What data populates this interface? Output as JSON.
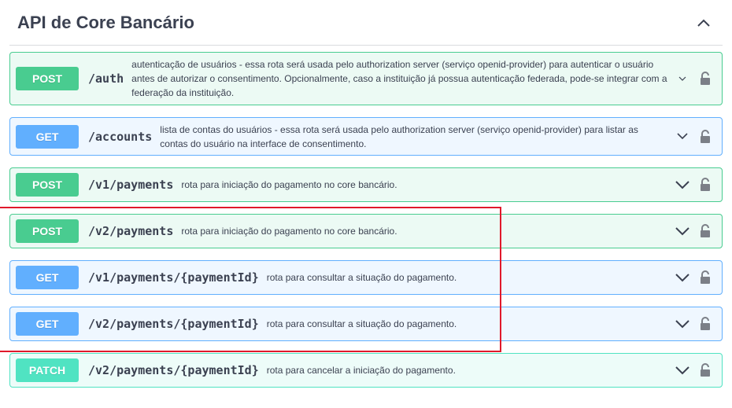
{
  "section": {
    "title": "API de Core Bancário"
  },
  "operations": [
    {
      "method": "POST",
      "path": "/auth",
      "summary": "autenticação de usuários - essa rota será usada pelo authorization server (serviço openid-provider) para autenticar o usuário antes de autorizar o consentimento. Opcionalmente, caso a instituição já possua autenticação federada, pode-se integrar com a federação da instituição."
    },
    {
      "method": "GET",
      "path": "/accounts",
      "summary": "lista de contas do usuários - essa rota será usada pelo authorization server (serviço openid-provider) para listar as contas do usuário na interface de consentimento."
    },
    {
      "method": "POST",
      "path": "/v1/payments",
      "summary": "rota para iniciação do pagamento no core bancário."
    },
    {
      "method": "POST",
      "path": "/v2/payments",
      "summary": "rota para iniciação do pagamento no core bancário."
    },
    {
      "method": "GET",
      "path": "/v1/payments/{paymentId}",
      "summary": "rota para consultar a situação do pagamento."
    },
    {
      "method": "GET",
      "path": "/v2/payments/{paymentId}",
      "summary": "rota para consultar a situação do pagamento."
    },
    {
      "method": "PATCH",
      "path": "/v2/payments/{paymentId}",
      "summary": "rota para cancelar a iniciação do pagamento."
    }
  ],
  "colors": {
    "post": "#49cc90",
    "get": "#61affe",
    "patch": "#50e3c2",
    "highlight": "#e0192b"
  }
}
